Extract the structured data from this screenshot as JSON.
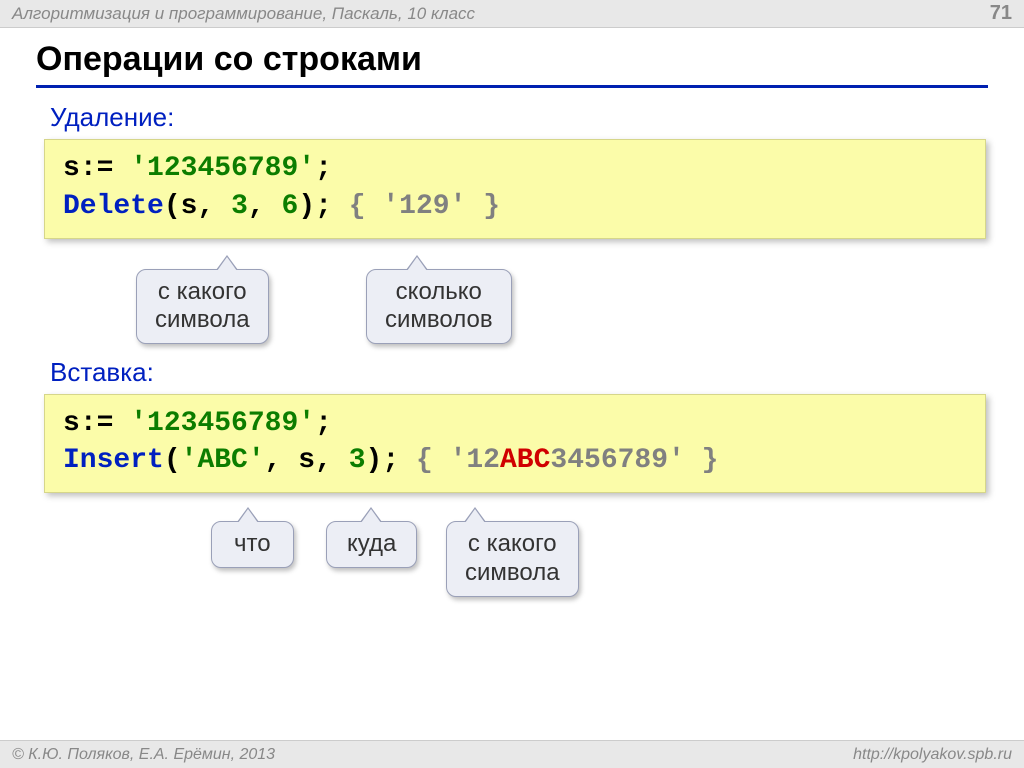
{
  "header": {
    "course": "Алгоритмизация и программирование, Паскаль, 10 класс",
    "pageNumber": "71"
  },
  "title": "Операции со строками",
  "sections": {
    "delete": {
      "label": "Удаление:",
      "code": {
        "s": "s",
        "assign": ":=",
        "literal": "'123456789'",
        "semi": ";",
        "fn": "Delete",
        "open": "(",
        "arg1": "s",
        "comma1": ",",
        "arg2": "3",
        "comma2": ",",
        "arg3": "6",
        "close": ");",
        "commentOpen": "{",
        "commentVal": "'129'",
        "commentClose": "}"
      },
      "callouts": {
        "from": "с какого\nсимвола",
        "count": "сколько\nсимволов"
      }
    },
    "insert": {
      "label": "Вставка:",
      "code": {
        "s": "s",
        "assign": ":=",
        "literal": "'123456789'",
        "semi": ";",
        "fn": "Insert",
        "open": "(",
        "arg1": "'ABC'",
        "comma1": ",",
        "arg2": "s",
        "comma2": ",",
        "arg3": "3",
        "close": ");",
        "commentOpen": "{",
        "commentPre": "'12",
        "commentRed": "ABC",
        "commentPost": "3456789'",
        "commentClose": "}"
      },
      "callouts": {
        "what": "что",
        "where": "куда",
        "from": "с какого\nсимвола"
      }
    }
  },
  "footer": {
    "copyright": "© К.Ю. Поляков, Е.А. Ерёмин, 2013",
    "url": "http://kpolyakov.spb.ru"
  }
}
